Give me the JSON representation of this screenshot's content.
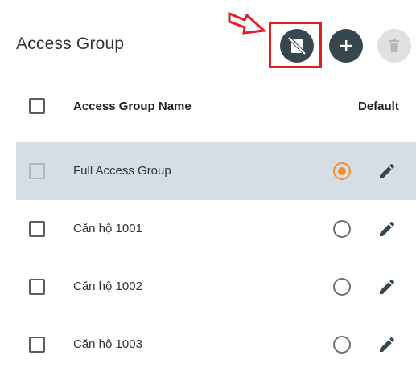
{
  "page": {
    "title": "Access Group"
  },
  "toolbar": {
    "no_card_icon": "credit-card-off-icon",
    "add_icon": "plus-icon",
    "delete_icon": "trash-icon",
    "accent_dark": "#37474f",
    "annotation_color": "#e11d24"
  },
  "table": {
    "columns": {
      "name": "Access Group Name",
      "default": "Default"
    },
    "rows": [
      {
        "name": "Full Access Group",
        "default": true,
        "selected": true
      },
      {
        "name": "Căn hộ 1001",
        "default": false,
        "selected": false
      },
      {
        "name": "Căn hộ 1002",
        "default": false,
        "selected": false
      },
      {
        "name": "Căn hộ 1003",
        "default": false,
        "selected": false
      }
    ],
    "default_color": "#f0932b"
  }
}
